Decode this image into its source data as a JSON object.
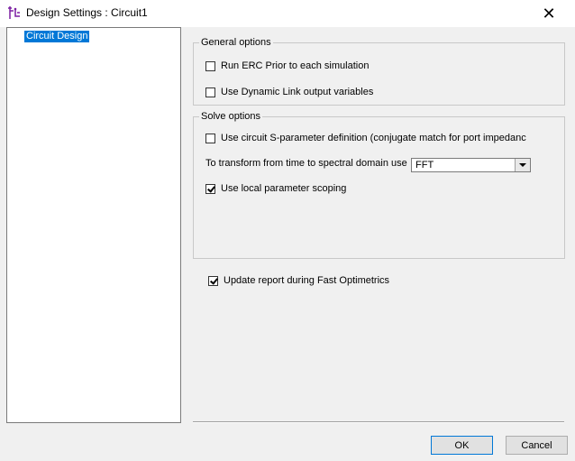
{
  "window": {
    "title": "Design Settings : Circuit1",
    "icon": "circuit-design-icon",
    "close_glyph": "✕"
  },
  "tree": {
    "items": [
      {
        "label": "Circuit Design",
        "selected": true
      }
    ]
  },
  "general_options": {
    "label": "General options",
    "run_erc": {
      "label": "Run ERC Prior to each simulation",
      "checked": false
    },
    "dynamic_link": {
      "label": "Use Dynamic Link output variables",
      "checked": false
    }
  },
  "solve_options": {
    "label": "Solve options",
    "sparam_def": {
      "label": "Use circuit S-parameter definition (conjugate match for port  impedanc",
      "checked": false
    },
    "transform_label": "To transform from time to spectral domain use",
    "transform_value": "FFT",
    "local_scoping": {
      "label": "Use local parameter scoping",
      "checked": true
    }
  },
  "update_report": {
    "label": "Update report during Fast Optimetrics",
    "checked": true
  },
  "buttons": {
    "ok": "OK",
    "cancel": "Cancel"
  },
  "colors": {
    "selection": "#0078d7",
    "background": "#f0f0f0"
  }
}
